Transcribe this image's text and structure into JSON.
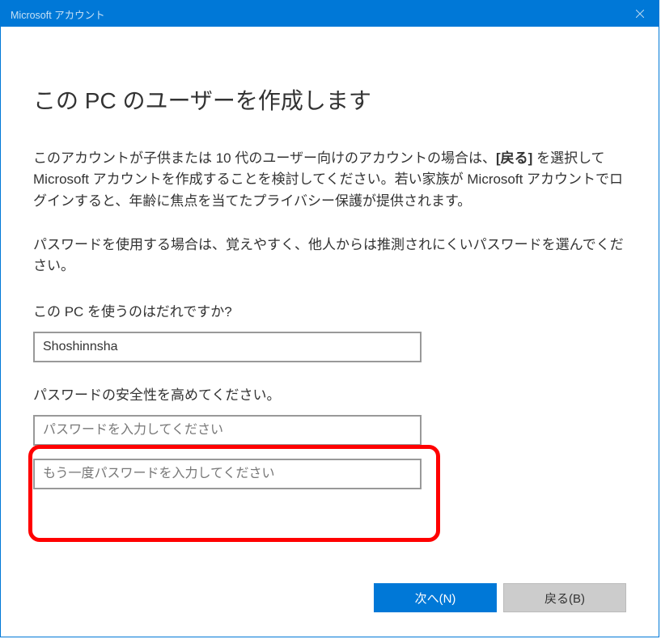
{
  "titlebar": {
    "title": "Microsoft アカウント"
  },
  "heading": "この PC のユーザーを作成します",
  "paragraph1_prefix": "このアカウントが子供または 10 代のユーザー向けのアカウントの場合は、",
  "paragraph1_bold": "[戻る]",
  "paragraph1_suffix": " を選択して Microsoft アカウントを作成することを検討してください。若い家族が Microsoft アカウントでログインすると、年齢に焦点を当てたプライバシー保護が提供されます。",
  "paragraph2": "パスワードを使用する場合は、覚えやすく、他人からは推測されにくいパスワードを選んでください。",
  "section_user": {
    "label": "この PC を使うのはだれですか?",
    "username_value": "Shoshinnsha"
  },
  "section_password": {
    "label": "パスワードの安全性を高めてください。",
    "password_placeholder": "パスワードを入力してください",
    "confirm_placeholder": "もう一度パスワードを入力してください"
  },
  "footer": {
    "next_label": "次へ(N)",
    "back_label": "戻る(B)"
  }
}
